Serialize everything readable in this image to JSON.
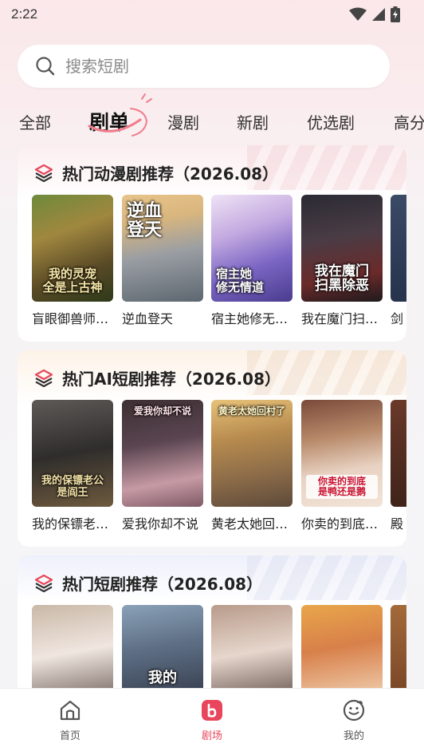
{
  "status": {
    "time": "2:22"
  },
  "search": {
    "placeholder": "搜索短剧"
  },
  "tabs": [
    {
      "label": "全部"
    },
    {
      "label": "剧单"
    },
    {
      "label": "漫剧"
    },
    {
      "label": "新剧"
    },
    {
      "label": "优选剧"
    },
    {
      "label": "高分"
    }
  ],
  "sections": [
    {
      "title": "热门动漫剧推荐（2026.08）",
      "items": [
        {
          "name": "盲眼御兽师…",
          "poster_text": "我的灵宠\n全是上古神"
        },
        {
          "name": "逆血登天",
          "poster_text": "逆血\n登天"
        },
        {
          "name": "宿主她修无…",
          "poster_text": "宿主她\n修无情道"
        },
        {
          "name": "我在魔门扫…",
          "poster_text": "我在魔门\n扫黑除恶"
        },
        {
          "name": "剑",
          "poster_text": ""
        }
      ]
    },
    {
      "title": "热门AI短剧推荐（2026.08）",
      "items": [
        {
          "name": "我的保镖老…",
          "poster_text": "我的保镖老公\n是阎王"
        },
        {
          "name": "爱我你却不说",
          "poster_text": "爱我你却不说"
        },
        {
          "name": "黄老太她回…",
          "poster_text": "黄老太她回村了"
        },
        {
          "name": "你卖的到底…",
          "poster_text": "你卖的到底\n是鸭还是鹅"
        },
        {
          "name": "殿",
          "poster_text": ""
        }
      ]
    },
    {
      "title": "热门短剧推荐（2026.08）",
      "items": [
        {
          "name": "",
          "poster_text": ""
        },
        {
          "name": "",
          "poster_text": "我的"
        },
        {
          "name": "",
          "poster_text": ""
        },
        {
          "name": "",
          "poster_text": ""
        },
        {
          "name": "",
          "poster_text": ""
        }
      ]
    }
  ],
  "bottom_nav": [
    {
      "label": "首页",
      "icon": "home-icon"
    },
    {
      "label": "剧场",
      "icon": "theater-icon"
    },
    {
      "label": "我的",
      "icon": "profile-icon"
    }
  ],
  "colors": {
    "accent": "#e8465c",
    "text": "#222222"
  }
}
